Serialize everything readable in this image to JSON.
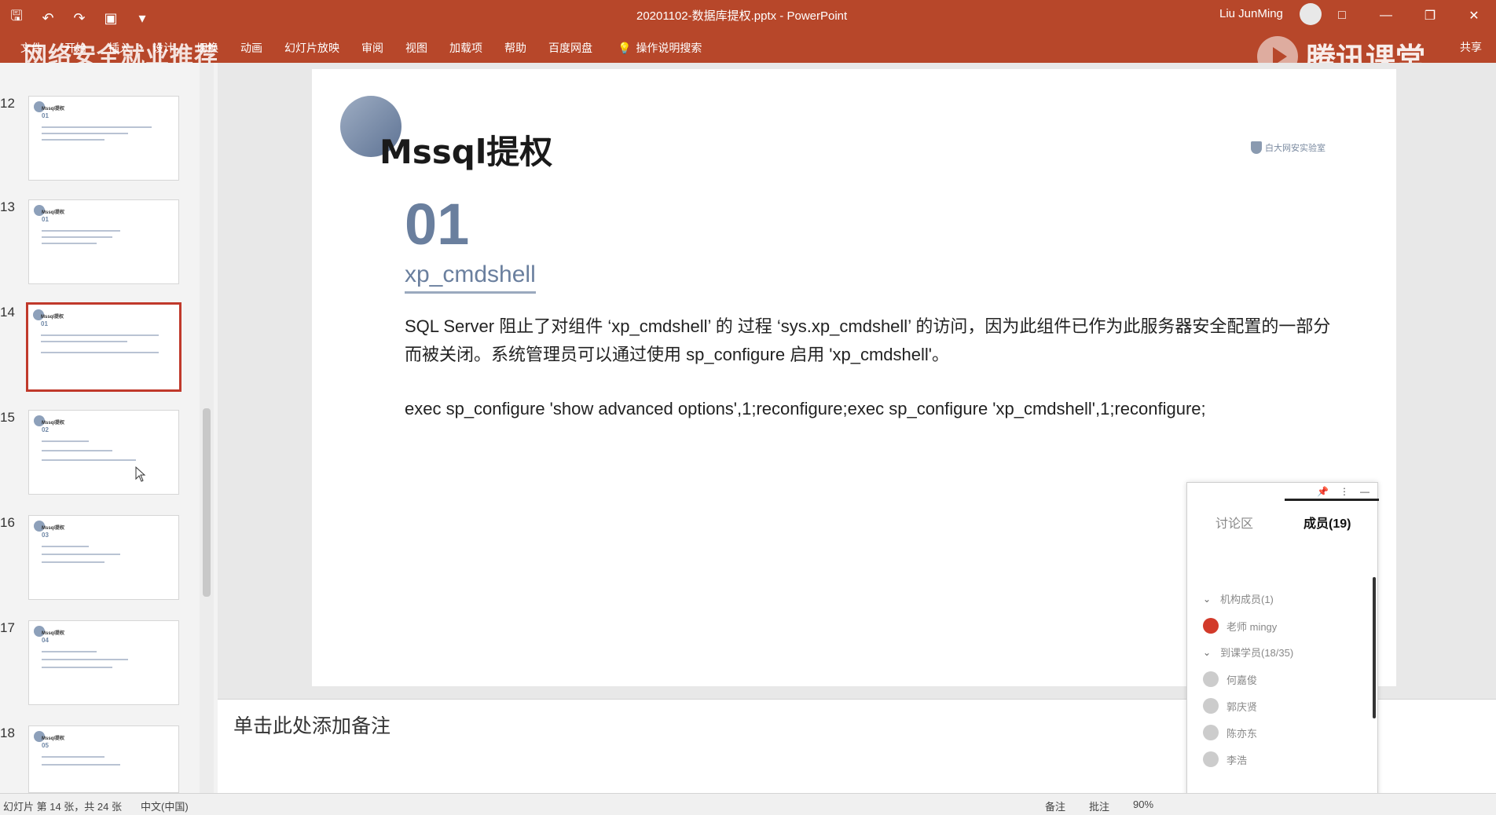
{
  "titlebar": {
    "quick_access": [
      "save-icon",
      "undo-icon",
      "redo-icon",
      "present-icon",
      "customize-icon"
    ],
    "doc_title": "20201102-数据库提权.pptx  -  PowerPoint",
    "user": "Liu JunMing",
    "window_buttons": [
      "□",
      "—",
      "❐",
      "✕"
    ]
  },
  "ribbon": {
    "tabs": [
      "文件",
      "开始",
      "插入",
      "设计",
      "切换",
      "动画",
      "幻灯片放映",
      "审阅",
      "视图",
      "加载项",
      "帮助",
      "百度网盘"
    ],
    "search_label": "操作说明搜索",
    "share_label": "共享",
    "overlay_banner": "网络安全就业推荐",
    "overlay_logo": "腾讯课堂"
  },
  "thumbnails": [
    {
      "num": "12",
      "sec": "01",
      "active": false
    },
    {
      "num": "13",
      "sec": "01",
      "active": false
    },
    {
      "num": "14",
      "sec": "01",
      "active": true
    },
    {
      "num": "15",
      "sec": "02",
      "active": false
    },
    {
      "num": "16",
      "sec": "03",
      "active": false
    },
    {
      "num": "17",
      "sec": "04",
      "active": false
    },
    {
      "num": "18",
      "sec": "05",
      "active": false
    }
  ],
  "slide": {
    "title": "Mssql提权",
    "logo_text": "白大网安实验室",
    "section_number": "01",
    "section_name": "xp_cmdshell",
    "paragraph": "SQL Server 阻止了对组件 ‘xp_cmdshell’ 的 过程 ‘sys.xp_cmdshell’ 的访问，因为此组件已作为此服务器安全配置的一部分而被关闭。系统管理员可以通过使用 sp_configure 启用 'xp_cmdshell'。",
    "command": "exec sp_configure 'show advanced options',1;reconfigure;exec sp_configure 'xp_cmdshell',1;reconfigure;"
  },
  "notes": {
    "placeholder": "单击此处添加备注"
  },
  "chat": {
    "tab_discussion": "讨论区",
    "tab_members": "成员(19)",
    "group_org": "机构成员(1)",
    "teacher": "老师  mingy",
    "group_students": "到课学员(18/35)",
    "students": [
      "何嘉俊",
      "郭庆贤",
      "陈亦东",
      "李浩"
    ]
  },
  "statusbar": {
    "slide_info": "幻灯片 第 14 张，共 24 张",
    "language": "中文(中国)",
    "notes_label": "备注",
    "comments_label": "批注",
    "zoom": "90%"
  }
}
